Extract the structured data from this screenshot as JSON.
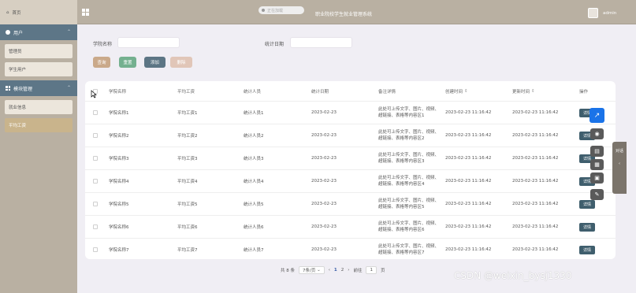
{
  "header": {
    "home_label": "首页",
    "app_title": "职业院校学生就业管理系统",
    "toast_text": "正在加载",
    "username": "admin"
  },
  "sidebar": {
    "groups": [
      {
        "label": "用户",
        "items": [
          "管理员",
          "学生用户"
        ]
      },
      {
        "label": "模块管理",
        "items": [
          "就业信息",
          "平均工资"
        ]
      }
    ],
    "active_item": "平均工资"
  },
  "search": {
    "college_label": "学院名称",
    "college_value": "",
    "stat_date_label": "统计日期",
    "stat_date_value": ""
  },
  "toolbar": {
    "query": "查询",
    "reset": "重置",
    "add": "添加",
    "delete": "删除"
  },
  "table": {
    "columns": [
      "学院名称",
      "平均工资",
      "统计人员",
      "统计日期",
      "备注详情",
      "创建时间",
      "更新时间",
      "操作"
    ],
    "rows": [
      {
        "college": "学院名称1",
        "salary": "平均工资1",
        "staff": "统计人员1",
        "date": "2023-02-23",
        "remark": "此处可上传文字、图片、视频、超链接、表格等内容区1",
        "created": "2023-02-23 11:16:42",
        "updated": "2023-02-23 11:16:42",
        "action": "详情"
      },
      {
        "college": "学院名称2",
        "salary": "平均工资2",
        "staff": "统计人员2",
        "date": "2023-02-23",
        "remark": "此处可上传文字、图片、视频、超链接、表格等内容区2",
        "created": "2023-02-23 11:16:42",
        "updated": "2023-02-23 11:16:42",
        "action": "详情"
      },
      {
        "college": "学院名称3",
        "salary": "平均工资3",
        "staff": "统计人员3",
        "date": "2023-02-23",
        "remark": "此处可上传文字、图片、视频、超链接、表格等内容区3",
        "created": "2023-02-23 11:16:42",
        "updated": "2023-02-23 11:16:42",
        "action": "详情"
      },
      {
        "college": "学院名称4",
        "salary": "平均工资4",
        "staff": "统计人员4",
        "date": "2023-02-23",
        "remark": "此处可上传文字、图片、视频、超链接、表格等内容区4",
        "created": "2023-02-23 11:16:42",
        "updated": "2023-02-23 11:16:42",
        "action": "详情"
      },
      {
        "college": "学院名称5",
        "salary": "平均工资5",
        "staff": "统计人员5",
        "date": "2023-02-23",
        "remark": "此处可上传文字、图片、视频、超链接、表格等内容区5",
        "created": "2023-02-23 11:16:42",
        "updated": "2023-02-23 11:16:42",
        "action": "详情"
      },
      {
        "college": "学院名称6",
        "salary": "平均工资6",
        "staff": "统计人员6",
        "date": "2023-02-23",
        "remark": "此处可上传文字、图片、视频、超链接、表格等内容区6",
        "created": "2023-02-23 11:16:42",
        "updated": "2023-02-23 11:16:42",
        "action": "详情"
      },
      {
        "college": "学院名称7",
        "salary": "平均工资7",
        "staff": "统计人员7",
        "date": "2023-02-23",
        "remark": "此处可上传文字、图片、视频、超链接、表格等内容区7",
        "created": "2023-02-23 11:16:42",
        "updated": "2023-02-23 11:16:42",
        "action": "详情"
      }
    ]
  },
  "pagination": {
    "total": "共 8 条",
    "page_size": "7条/页",
    "prev": "‹",
    "pages": [
      "1",
      "2"
    ],
    "current": "1",
    "next": "›",
    "goto_label": "前往",
    "goto_value": "1",
    "page_suffix": "页"
  },
  "right_tab": {
    "label": "对话"
  },
  "watermark": "CSDN @weixin_bysj1330",
  "colors": {
    "sidebar_bg": "#b9b0a2",
    "menu_group_bg": "#5d7687",
    "active_item_bg": "#c9b48c",
    "detail_btn_bg": "#3f5e6d"
  }
}
